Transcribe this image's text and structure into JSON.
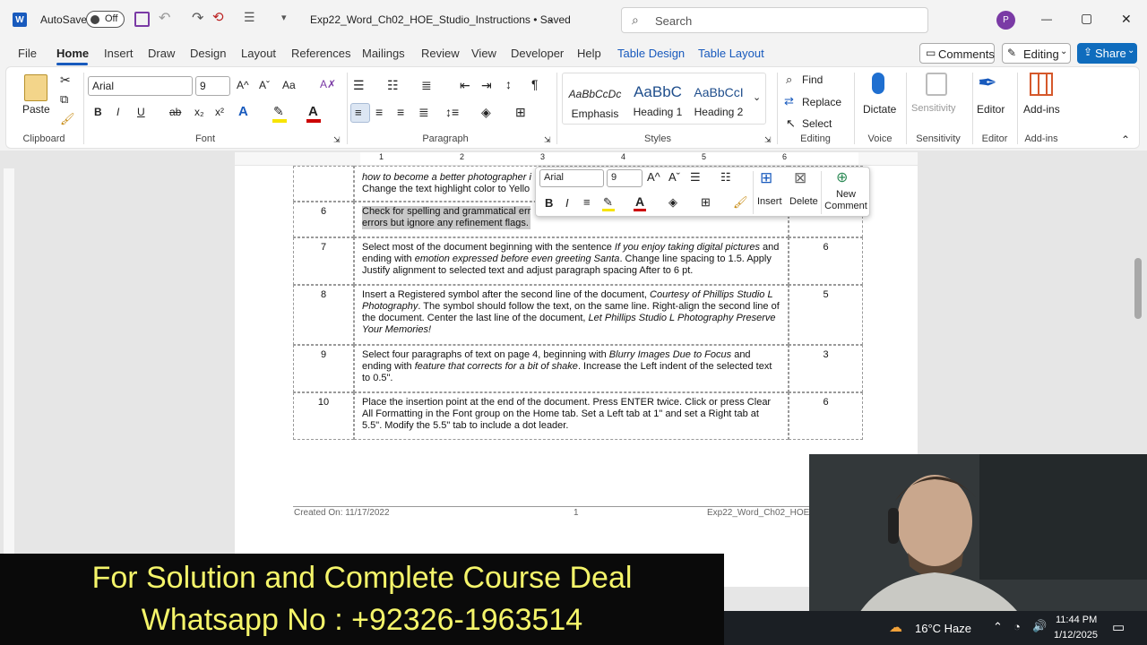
{
  "titlebar": {
    "autosave_label": "AutoSave",
    "autosave_state": "Off",
    "doc_title": "Exp22_Word_Ch02_HOE_Studio_Instructions • Saved",
    "search_placeholder": "Search",
    "avatar_initial": "P",
    "minimize": "—",
    "maximize": "▢",
    "close": "✕"
  },
  "tabs": [
    "File",
    "Home",
    "Insert",
    "Draw",
    "Design",
    "Layout",
    "References",
    "Mailings",
    "Review",
    "View",
    "Developer",
    "Help",
    "Table Design",
    "Table Layout"
  ],
  "actions": {
    "comments": "Comments",
    "editing": "Editing",
    "share": "Share"
  },
  "ribbon": {
    "clipboard": {
      "paste": "Paste",
      "group": "Clipboard"
    },
    "font": {
      "name": "Arial",
      "size": "9",
      "group": "Font",
      "bold": "B",
      "italic": "I",
      "underline": "U",
      "strike": "ab",
      "sub": "x₂",
      "sup": "x²",
      "grow": "A^",
      "shrink": "Aˇ",
      "case": "Aa"
    },
    "paragraph": {
      "group": "Paragraph"
    },
    "styles": {
      "group": "Styles",
      "items": [
        {
          "preview": "AaBbCcDc",
          "name": "Emphasis"
        },
        {
          "preview": "AaBbC",
          "name": "Heading 1"
        },
        {
          "preview": "AaBbCcI",
          "name": "Heading 2"
        }
      ]
    },
    "editing": {
      "find": "Find",
      "replace": "Replace",
      "select": "Select",
      "group": "Editing"
    },
    "voice": {
      "dictate": "Dictate",
      "group": "Voice"
    },
    "sensitivity": {
      "label": "Sensitivity",
      "group": "Sensitivity"
    },
    "editor": {
      "label": "Editor",
      "group": "Editor"
    },
    "addins": {
      "label": "Add-ins",
      "group": "Add-ins"
    }
  },
  "ruler": {
    "marks": [
      "1",
      "2",
      "3",
      "4",
      "5",
      "6"
    ]
  },
  "table": {
    "rows": [
      {
        "num": "",
        "text_html": "<i>how to become a better photographer i</i><br>Change the text highlight color to Yello",
        "points": ""
      },
      {
        "num": "6",
        "text": "Check for spelling and grammatical err\nerrors but ignore any refinement flags.",
        "points": ""
      },
      {
        "num": "7",
        "text_html": "Select most of the document beginning with the sentence <i>If you enjoy taking digital pictures</i> and ending with <i>emotion expressed before even greeting Santa</i>. Change line spacing to 1.5. Apply Justify alignment to selected text and adjust paragraph spacing After to 6 pt.",
        "points": "6"
      },
      {
        "num": "8",
        "text_html": "Insert a Registered symbol after the second line of the document, <i>Courtesy of Phillips Studio L Photography</i>. The symbol should follow the text, on the same line. Right-align the second line of the document. Center the last line of the document, <i>Let Phillips Studio L Photography Preserve Your Memories!</i>",
        "points": "5"
      },
      {
        "num": "9",
        "text_html": "Select four paragraphs of text on page 4, beginning with <i>Blurry Images Due to Focus</i> and ending with <i>feature that corrects for a bit of shake</i>. Increase the Left indent of the selected text to 0.5\".",
        "points": "3"
      },
      {
        "num": "10",
        "text": "Place the insertion point at the end of the document. Press ENTER twice. Click or press Clear All Formatting in the Font group on the Home tab. Set a Left tab at 1\" and set a Right tab at 5.5\". Modify the 5.5\" tab to include a dot leader.",
        "points": "6"
      }
    ]
  },
  "footer": {
    "created": "Created On: 11/17/2022",
    "page": "1",
    "file": "Exp22_Word_Ch02_HOE"
  },
  "mini_toolbar": {
    "font": "Arial",
    "size": "9",
    "insert": "Insert",
    "delete": "Delete",
    "new_comment": "New\nComment"
  },
  "banner": {
    "line1": "For Solution and Complete Course Deal",
    "line2": "Whatsapp No : +92326-1963514"
  },
  "taskbar": {
    "weather": "16°C  Haze",
    "time": "11:44 PM",
    "date": "1/12/2025"
  },
  "colors": {
    "accent": "#185abd",
    "share": "#0f6cbd",
    "banner_text": "#f5f56a",
    "avatar": "#7a3aa5"
  }
}
